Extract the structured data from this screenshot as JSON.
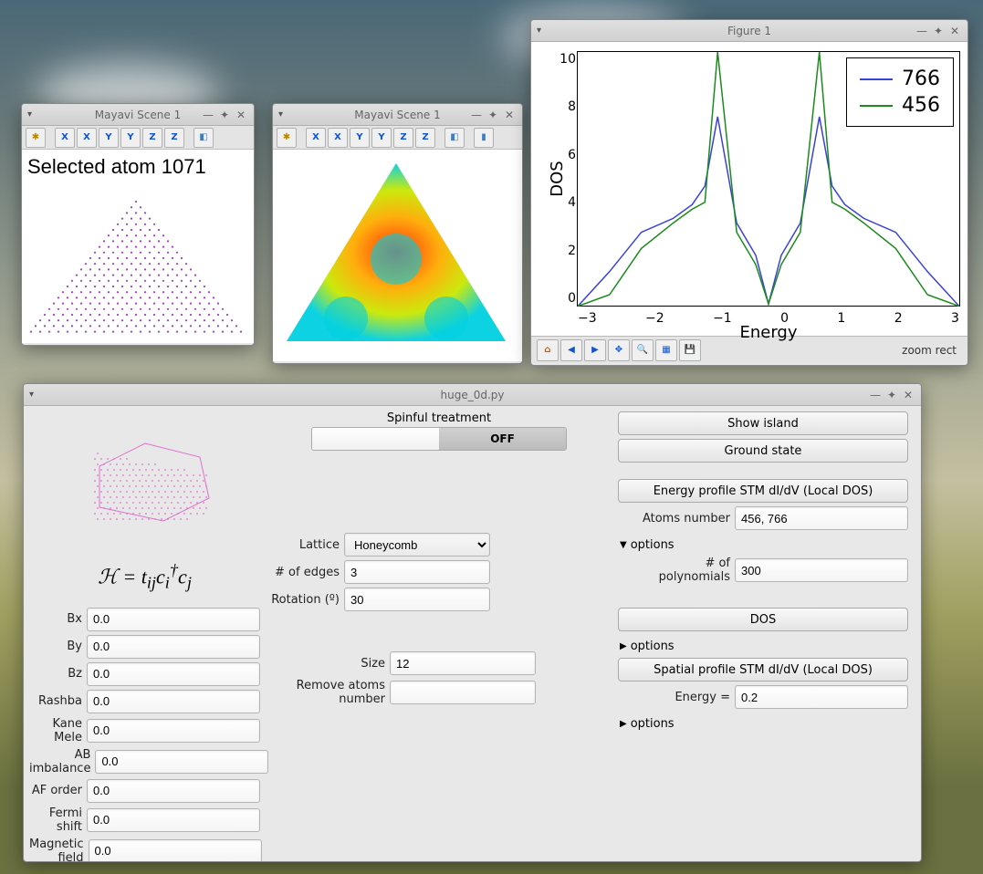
{
  "mayavi_windows": [
    {
      "title": "Mayavi Scene 1",
      "selected_text": "Selected atom 1071"
    },
    {
      "title": "Mayavi Scene 1",
      "selected_text": ""
    }
  ],
  "mayavi_toolbar_icons": [
    "axes",
    "X+",
    "X-",
    "Y+",
    "Y-",
    "Z+",
    "Z-",
    "iso"
  ],
  "figure_window": {
    "title": "Figure 1",
    "status": "zoom rect",
    "nav_icons": [
      "home",
      "back",
      "forward",
      "pan",
      "zoom",
      "subplots",
      "save"
    ]
  },
  "chart_data": {
    "type": "line",
    "xlabel": "Energy",
    "ylabel": "DOS",
    "xlim": [
      -3,
      3
    ],
    "ylim": [
      0,
      11
    ],
    "xticks": [
      -3,
      -2,
      -1,
      0,
      1,
      2,
      3
    ],
    "yticks": [
      0,
      2,
      4,
      6,
      8,
      10
    ],
    "series": [
      {
        "name": "766",
        "color": "#3a41d8",
        "x": [
          -3,
          -2.5,
          -2,
          -1.5,
          -1.2,
          -1,
          -0.8,
          -0.5,
          -0.2,
          0,
          0.2,
          0.5,
          0.8,
          1,
          1.2,
          1.5,
          2,
          2.5,
          3
        ],
        "y": [
          0,
          1.5,
          3.2,
          3.8,
          4.4,
          5.2,
          8.2,
          3.6,
          2.2,
          0.1,
          2.2,
          3.6,
          8.2,
          5.2,
          4.4,
          3.8,
          3.2,
          1.5,
          0
        ]
      },
      {
        "name": "456",
        "color": "#1a8a1a",
        "x": [
          -3,
          -2.5,
          -2,
          -1.5,
          -1.2,
          -1,
          -0.8,
          -0.5,
          -0.2,
          0,
          0.2,
          0.5,
          0.8,
          1,
          1.2,
          1.5,
          2,
          2.5,
          3
        ],
        "y": [
          0,
          0.5,
          2.5,
          3.6,
          4.2,
          4.5,
          11,
          3.2,
          1.8,
          0.1,
          1.8,
          3.2,
          11,
          4.5,
          4.2,
          3.6,
          2.5,
          0.5,
          0
        ]
      }
    ]
  },
  "control_window": {
    "title": "huge_0d.py",
    "spinful_label": "Spinful treatment",
    "spinful_value": "OFF",
    "hamiltonian_eqn": "H = tᵢⱼcᵢ†cⱼ",
    "left_fields": [
      {
        "label": "Bx",
        "value": "0.0"
      },
      {
        "label": "By",
        "value": "0.0"
      },
      {
        "label": "Bz",
        "value": "0.0"
      },
      {
        "label": "Rashba",
        "value": "0.0"
      },
      {
        "label": "Kane Mele",
        "value": "0.0"
      },
      {
        "label": "AB imbalance",
        "value": "0.0"
      },
      {
        "label": "AF order",
        "value": "0.0"
      },
      {
        "label": "Fermi shift",
        "value": "0.0"
      },
      {
        "label": "Magnetic field",
        "value": "0.0"
      }
    ],
    "lattice": {
      "label": "Lattice",
      "value": "Honeycomb"
    },
    "edges": {
      "label": "# of edges",
      "value": "3"
    },
    "rotation": {
      "label": "Rotation (º)",
      "value": "30"
    },
    "size": {
      "label": "Size",
      "value": "12"
    },
    "remove": {
      "label": "Remove atoms number",
      "value": ""
    },
    "right": {
      "btn_show_island": "Show island",
      "btn_ground_state": "Ground state",
      "btn_energy_profile": "Energy profile STM dI/dV (Local DOS)",
      "atoms_number": {
        "label": "Atoms number",
        "value": "456, 766"
      },
      "options_label": "options",
      "polynomials": {
        "label": "# of polynomials",
        "value": "300"
      },
      "btn_dos": "DOS",
      "btn_spatial": "Spatial profile STM dI/dV (Local DOS)",
      "energy": {
        "label": "Energy =",
        "value": "0.2"
      }
    }
  }
}
